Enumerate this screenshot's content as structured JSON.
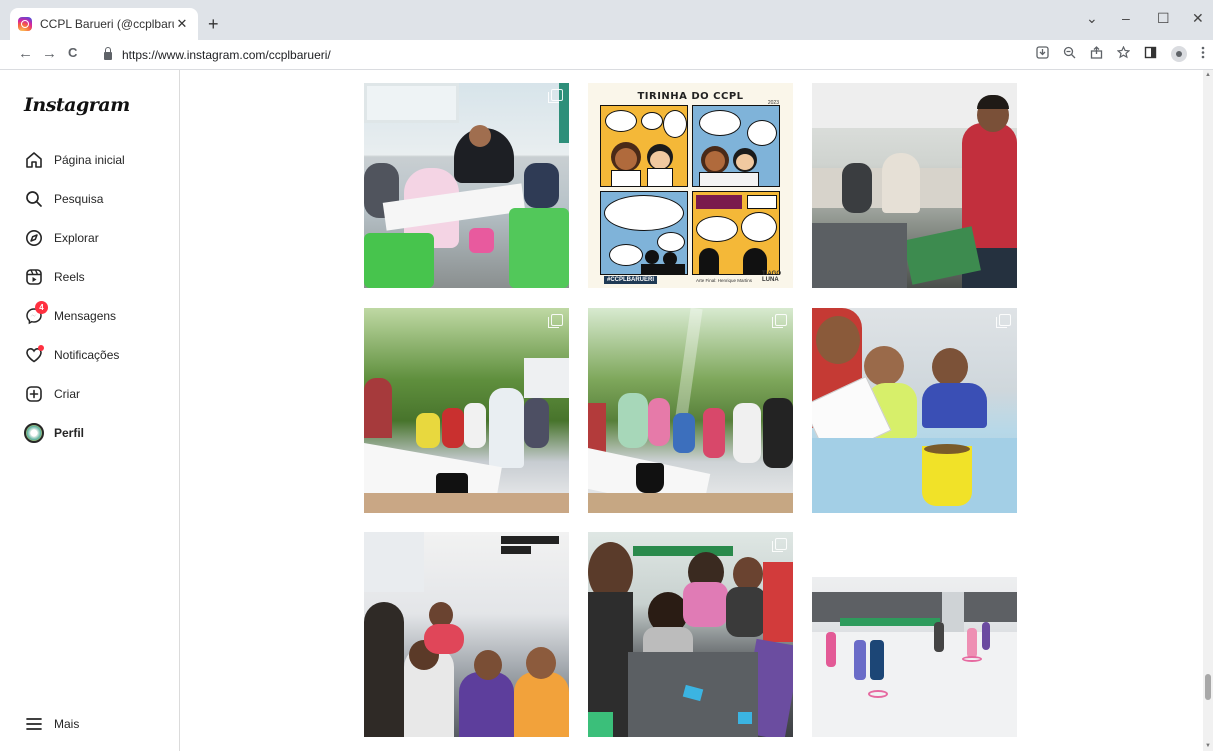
{
  "browser": {
    "tab_title": "CCPL Barueri (@ccplbarueri) • Fo",
    "tab_close": "✕",
    "new_tab": "+",
    "url": "https://www.instagram.com/ccplbarueri/",
    "window_controls": {
      "dropdown": "⌄",
      "minimize": "–",
      "maximize": "☐",
      "close": "✕"
    },
    "nav": {
      "back": "←",
      "forward": "→",
      "reload": "C"
    },
    "toolbar_icons": [
      "install-icon",
      "zoom-icon",
      "share-icon",
      "star-icon",
      "sidepanel-icon",
      "profile-icon",
      "menu-icon"
    ]
  },
  "sidebar": {
    "logo": "Instagram",
    "items": [
      {
        "label": "Página inicial",
        "icon": "home-icon"
      },
      {
        "label": "Pesquisa",
        "icon": "search-icon"
      },
      {
        "label": "Explorar",
        "icon": "compass-icon"
      },
      {
        "label": "Reels",
        "icon": "reels-icon"
      },
      {
        "label": "Mensagens",
        "icon": "messenger-icon",
        "badge": "4"
      },
      {
        "label": "Notificações",
        "icon": "heart-icon"
      },
      {
        "label": "Criar",
        "icon": "plus-square-icon"
      },
      {
        "label": "Perfil",
        "icon": "profile-avatar"
      }
    ],
    "more": {
      "label": "Mais",
      "icon": "hamburger-icon"
    }
  },
  "comic": {
    "title": "TIRINHA DO CCPL",
    "year": "2023",
    "hashtag": "#CCPLBARUERI",
    "credit": "Arte Final: Henrique Martins",
    "signature": "TIAGO\nLUNA"
  },
  "posts": [
    {
      "name": "post-classroom-writing",
      "multi": true
    },
    {
      "name": "post-tirinha-comic",
      "multi": false
    },
    {
      "name": "post-classroom-teacher",
      "multi": false
    },
    {
      "name": "post-kids-outdoor-line-1",
      "multi": true
    },
    {
      "name": "post-kids-outdoor-line-2",
      "multi": true
    },
    {
      "name": "post-kids-coloring",
      "multi": true
    },
    {
      "name": "post-group-selfie",
      "multi": false
    },
    {
      "name": "post-kids-crafts",
      "multi": true
    },
    {
      "name": "post-gym-hall",
      "multi": true
    }
  ],
  "colors": {
    "badge": "#ff3040",
    "border": "#dbdbdb",
    "text": "#262626"
  }
}
